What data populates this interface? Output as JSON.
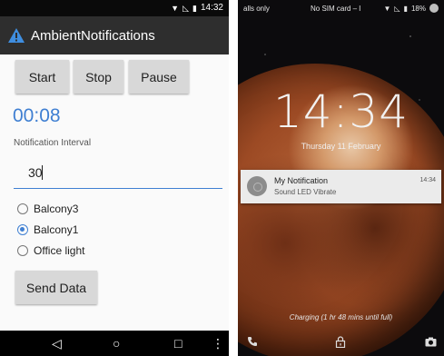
{
  "left_phone": {
    "status_bar": {
      "time": "14:32"
    },
    "app_title": "AmbientNotifications",
    "buttons": {
      "start": "Start",
      "stop": "Stop",
      "pause": "Pause",
      "send": "Send Data"
    },
    "timer": "00:08",
    "interval": {
      "label": "Notification Interval",
      "value": "30"
    },
    "radios": [
      {
        "label": "Balcony3",
        "checked": false
      },
      {
        "label": "Balcony1",
        "checked": true
      },
      {
        "label": "Office light",
        "checked": false
      }
    ],
    "nav": {
      "back": "◁",
      "home": "○",
      "recents": "□",
      "menu": "⋮"
    }
  },
  "right_phone": {
    "status_bar": {
      "carrier": "alls only",
      "sim": "No SIM card – l",
      "battery": "18%"
    },
    "clock": "14:34",
    "date": "Thursday 11 February",
    "notification": {
      "title": "My Notification",
      "text": "Sound LED Vibrate",
      "time": "14:34"
    },
    "charging": "Charging (1 hr 48 mins until full)"
  },
  "colors": {
    "accent": "#3f7fd2",
    "actionbar": "#2e2e2e",
    "button": "#d8d8d8"
  }
}
